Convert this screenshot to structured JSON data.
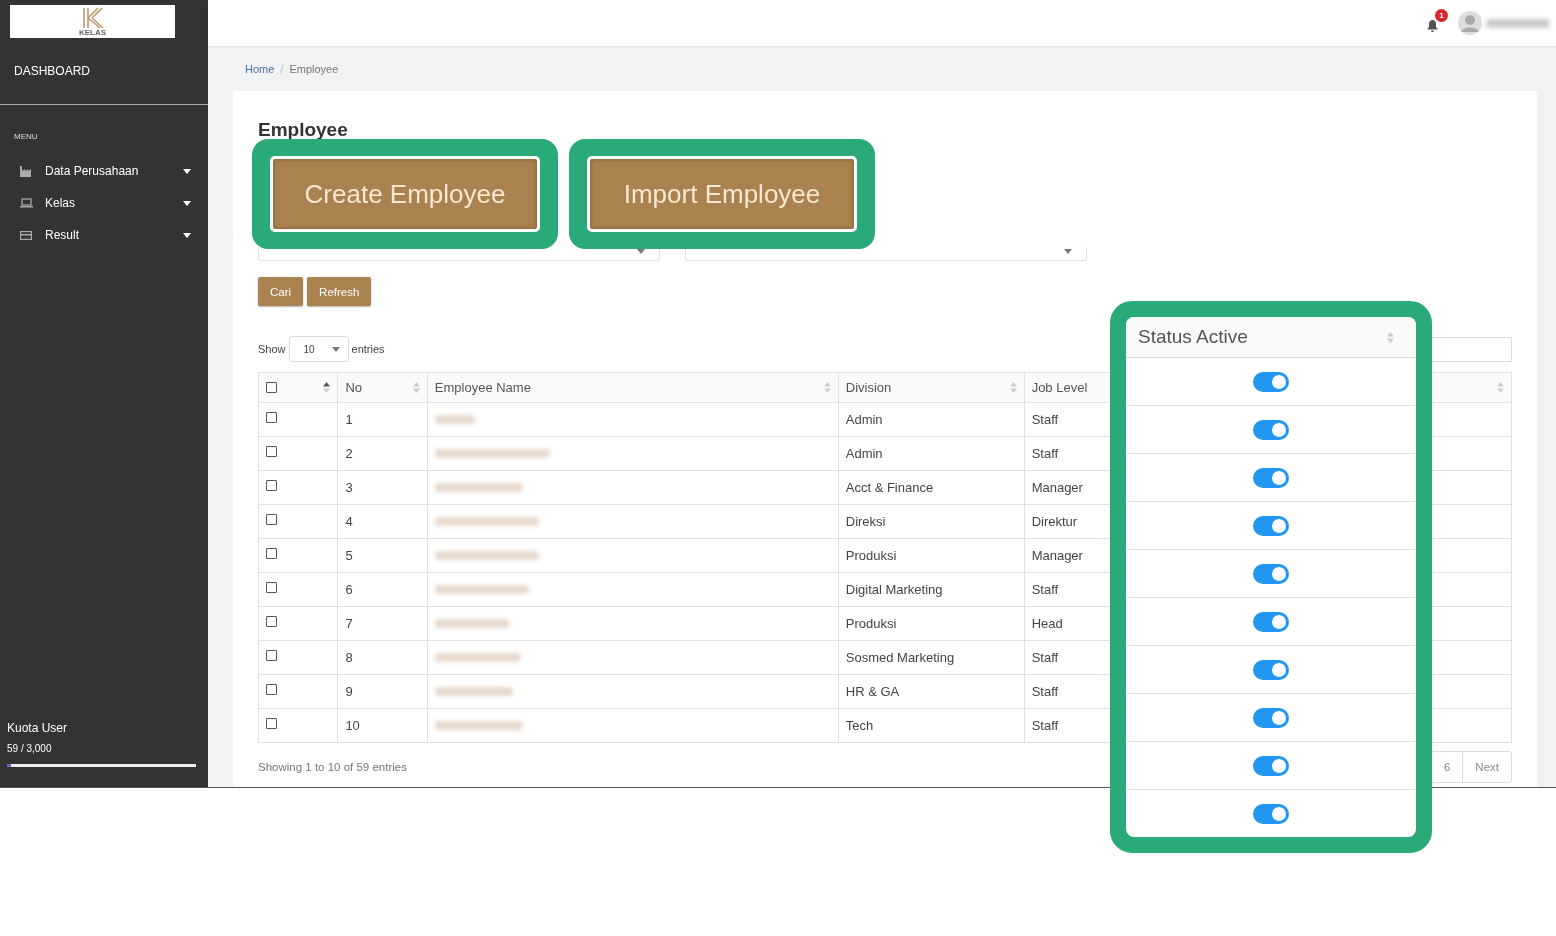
{
  "sidebar": {
    "logo_text": "KELAS",
    "title": "DASHBOARD",
    "menu_label": "MENU",
    "items": [
      {
        "label": "Data Perusahaan",
        "kind": "chart"
      },
      {
        "label": "Kelas",
        "kind": "laptop"
      },
      {
        "label": "Result",
        "kind": "card"
      }
    ],
    "quota": {
      "label": "Kuota User",
      "value": "59 / 3,000",
      "level": 0.02
    }
  },
  "header": {
    "notification_count": "1"
  },
  "breadcrumb": {
    "items": [
      "Home",
      "Employee"
    ],
    "separator": "/"
  },
  "page_title": "Employee",
  "callout_buttons": [
    "Create Employee",
    "Import Employee"
  ],
  "buttons": [
    "Cari",
    "Refresh"
  ],
  "length": {
    "before": "Show",
    "value": "10",
    "after": "entries"
  },
  "table": {
    "select_all_checked": false,
    "columns": [
      "No",
      "Employee Name",
      "Division",
      "Job Level"
    ],
    "rows": [
      {
        "checked": false,
        "no": "1",
        "division": "Admin",
        "job_level": "Staff"
      },
      {
        "checked": false,
        "no": "2",
        "division": "Admin",
        "job_level": "Staff"
      },
      {
        "checked": false,
        "no": "3",
        "division": "Acct & Finance",
        "job_level": "Manager"
      },
      {
        "checked": false,
        "no": "4",
        "division": "Direksi",
        "job_level": "Direktur"
      },
      {
        "checked": false,
        "no": "5",
        "division": "Produksi",
        "job_level": "Manager"
      },
      {
        "checked": false,
        "no": "6",
        "division": "Digital Marketing",
        "job_level": "Staff"
      },
      {
        "checked": false,
        "no": "7",
        "division": "Produksi",
        "job_level": "Head"
      },
      {
        "checked": false,
        "no": "8",
        "division": "Sosmed Marketing",
        "job_level": "Staff"
      },
      {
        "checked": false,
        "no": "9",
        "division": "HR & GA",
        "job_level": "Staff"
      },
      {
        "checked": false,
        "no": "10",
        "division": "Tech",
        "job_level": "Staff"
      }
    ]
  },
  "info": "Showing 1 to 10 of 59 entries",
  "pagination": [
    "6",
    "Next"
  ],
  "status_callout": {
    "title": "Status Active",
    "rows": [
      {
        "on": true
      },
      {
        "on": true
      },
      {
        "on": true
      },
      {
        "on": true
      },
      {
        "on": true
      },
      {
        "on": true
      },
      {
        "on": true
      },
      {
        "on": true
      },
      {
        "on": true
      },
      {
        "on": true
      }
    ]
  }
}
